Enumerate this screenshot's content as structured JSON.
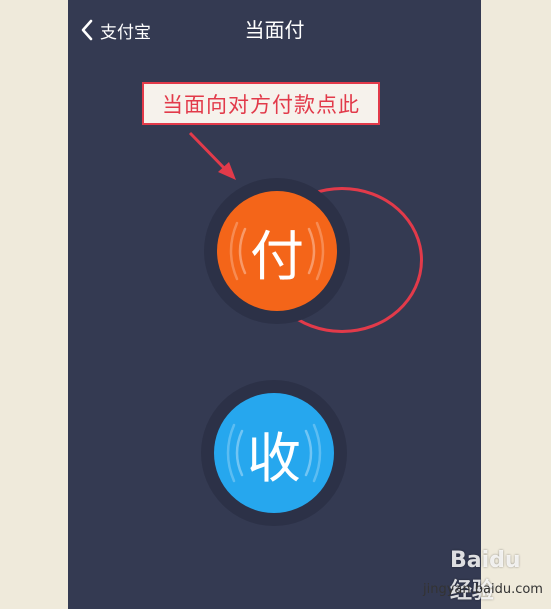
{
  "header": {
    "back_label": "支付宝",
    "title": "当面付"
  },
  "annotation": {
    "text": "当面向对方付款点此"
  },
  "buttons": {
    "pay": {
      "label": "付",
      "color": "#f46519"
    },
    "receive": {
      "label": "收",
      "color": "#26a7ee"
    }
  },
  "watermark": {
    "logo": "Baidu 经验",
    "url": "jingyan.baidu.com"
  },
  "colors": {
    "screen_bg": "#343a52",
    "page_bg": "#efeadb",
    "annotation_red": "#e23a4a"
  }
}
